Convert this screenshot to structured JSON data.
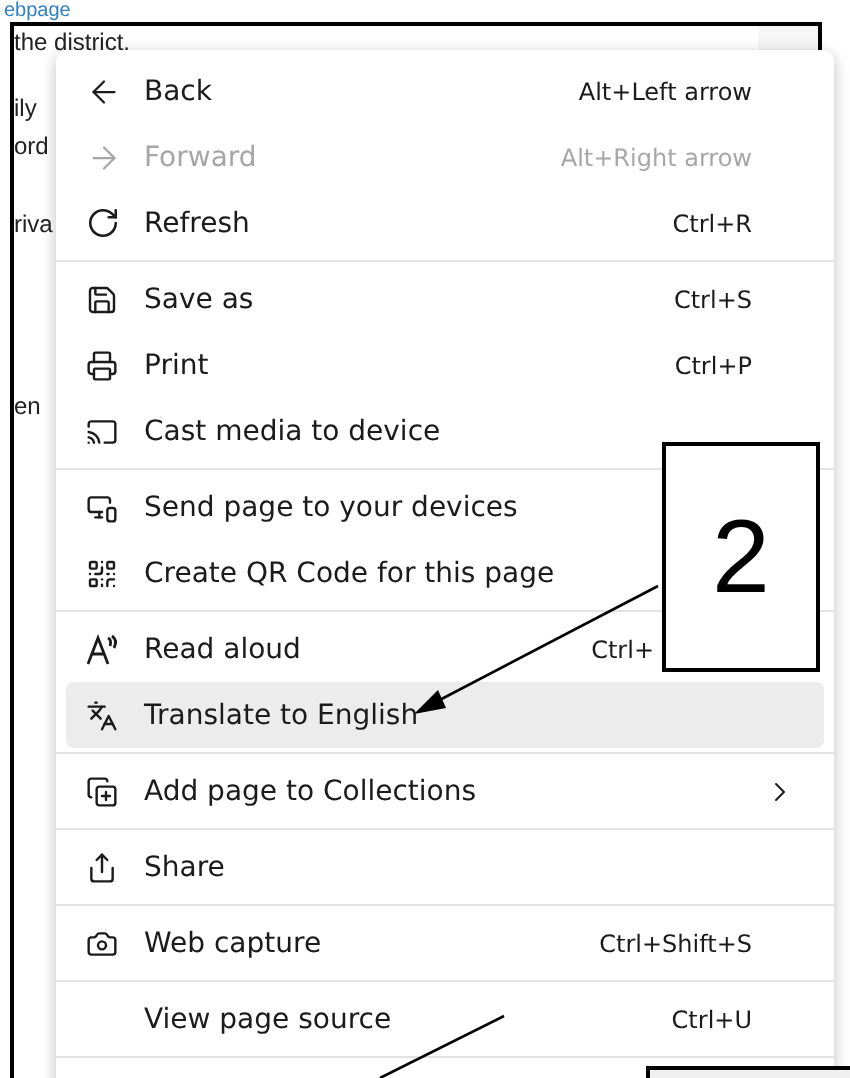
{
  "page": {
    "link": "ebpage",
    "lines": [
      "the district.",
      "ily",
      "ord",
      "riva",
      "en"
    ]
  },
  "menu": {
    "groups": [
      {
        "items": [
          {
            "label": "Back",
            "shortcut": "Alt+Left arrow",
            "disabled": false,
            "selected": false,
            "has_submenu": false
          },
          {
            "label": "Forward",
            "shortcut": "Alt+Right arrow",
            "disabled": true,
            "selected": false,
            "has_submenu": false
          },
          {
            "label": "Refresh",
            "shortcut": "Ctrl+R",
            "disabled": false,
            "selected": false,
            "has_submenu": false
          }
        ]
      },
      {
        "items": [
          {
            "label": "Save as",
            "shortcut": "Ctrl+S",
            "disabled": false,
            "selected": false,
            "has_submenu": false
          },
          {
            "label": "Print",
            "shortcut": "Ctrl+P",
            "disabled": false,
            "selected": false,
            "has_submenu": false
          },
          {
            "label": "Cast media to device",
            "disabled": false,
            "selected": false,
            "has_submenu": false
          }
        ]
      },
      {
        "items": [
          {
            "label": "Send page to your devices",
            "disabled": false,
            "selected": false,
            "has_submenu": false
          },
          {
            "label": "Create QR Code for this page",
            "disabled": false,
            "selected": false,
            "has_submenu": false
          }
        ]
      },
      {
        "items": [
          {
            "label": "Read aloud",
            "shortcut": "Ctrl+",
            "disabled": false,
            "selected": false,
            "has_submenu": false
          },
          {
            "label": "Translate to English",
            "disabled": false,
            "selected": true,
            "has_submenu": false
          }
        ]
      },
      {
        "items": [
          {
            "label": "Add page to Collections",
            "disabled": false,
            "selected": false,
            "has_submenu": true
          }
        ]
      },
      {
        "items": [
          {
            "label": "Share",
            "disabled": false,
            "selected": false,
            "has_submenu": false
          }
        ]
      },
      {
        "items": [
          {
            "label": "Web capture",
            "shortcut": "Ctrl+Shift+S",
            "disabled": false,
            "selected": false,
            "has_submenu": false
          }
        ]
      },
      {
        "items": [
          {
            "label": "View page source",
            "shortcut": "Ctrl+U",
            "disabled": false,
            "selected": false,
            "has_submenu": false
          }
        ]
      }
    ]
  },
  "annotation": {
    "label": "2"
  }
}
